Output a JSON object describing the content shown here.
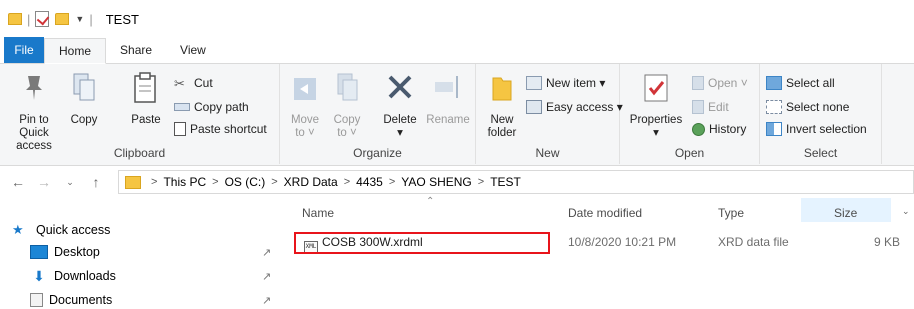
{
  "window": {
    "title": "TEST"
  },
  "tabs": [
    "File",
    "Home",
    "Share",
    "View"
  ],
  "ribbon": {
    "clipboard": {
      "label": "Clipboard",
      "pin_to_quick_access": [
        "Pin to Quick",
        "access"
      ],
      "copy": "Copy",
      "paste": "Paste",
      "cut": "Cut",
      "copy_path": "Copy path",
      "paste_shortcut": "Paste shortcut"
    },
    "organize": {
      "label": "Organize",
      "move_to": [
        "Move",
        "to ˅"
      ],
      "copy_to": [
        "Copy",
        "to ˅"
      ],
      "delete": "Delete",
      "delete_caret": "▾",
      "rename": "Rename"
    },
    "new": {
      "label": "New",
      "new_folder": [
        "New",
        "folder"
      ],
      "new_item": "New item ▾",
      "easy_access": "Easy access ▾"
    },
    "open": {
      "label": "Open",
      "properties": "Properties",
      "properties_caret": "▾",
      "open": "Open ˅",
      "edit": "Edit",
      "history": "History"
    },
    "select": {
      "label": "Select",
      "select_all": "Select all",
      "select_none": "Select none",
      "invert_selection": "Invert selection"
    }
  },
  "address": {
    "crumbs": [
      "This PC",
      "OS (C:)",
      "XRD Data",
      "4435",
      "YAO SHENG",
      "TEST"
    ]
  },
  "nav": {
    "quick_access": "Quick access",
    "items": [
      "Desktop",
      "Downloads",
      "Documents"
    ]
  },
  "list": {
    "columns": {
      "name": "Name",
      "date": "Date modified",
      "type": "Type",
      "size": "Size"
    },
    "rows": [
      {
        "icon_label": "XML",
        "name": "COSB 300W.xrdml",
        "date": "10/8/2020 10:21 PM",
        "type": "XRD data file",
        "size": "9 KB"
      }
    ]
  },
  "colors": {
    "accent": "#1979ca",
    "highlight_border": "#e8141b",
    "folder": "#f5c542"
  }
}
